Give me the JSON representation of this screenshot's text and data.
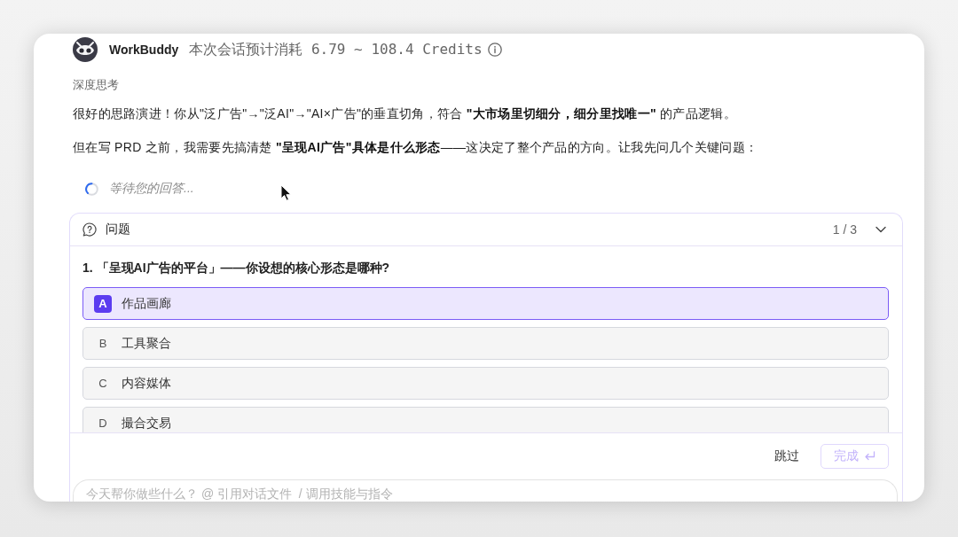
{
  "header": {
    "name": "WorkBuddy",
    "credits": "本次会话预计消耗 6.79 ~ 108.4 Credits"
  },
  "thinking_label": "深度思考",
  "paragraphs": [
    "很好的思路演进！你从\"泛广告\"→\"泛AI\"→\"AI×广告\"的垂直切角，符合 **\"大市场里切细分，细分里找唯一\"** 的产品逻辑。",
    "但在写 PRD 之前，我需要先搞清楚 **\"呈现AI广告\"具体是什么形态**——这决定了整个产品的方向。让我先问几个关键问题："
  ],
  "status": {
    "text": "等待您的回答..."
  },
  "question_panel": {
    "title": "问题",
    "progress": "1 / 3",
    "expanded": true,
    "question": "1. 「呈现AI广告的平台」——你设想的核心形态是哪种?",
    "options": [
      {
        "letter": "A",
        "label": "作品画廊",
        "selected": true
      },
      {
        "letter": "B",
        "label": "工具聚合",
        "selected": false
      },
      {
        "letter": "C",
        "label": "内容媒体",
        "selected": false
      },
      {
        "letter": "D",
        "label": "撮合交易",
        "selected": false
      }
    ],
    "skip": "跳过",
    "done": {
      "label": "完成",
      "disabled": true
    }
  },
  "composer": {
    "placeholder": "今天帮你做些什么？ @ 引用对话文件  / 调用技能与指令"
  }
}
